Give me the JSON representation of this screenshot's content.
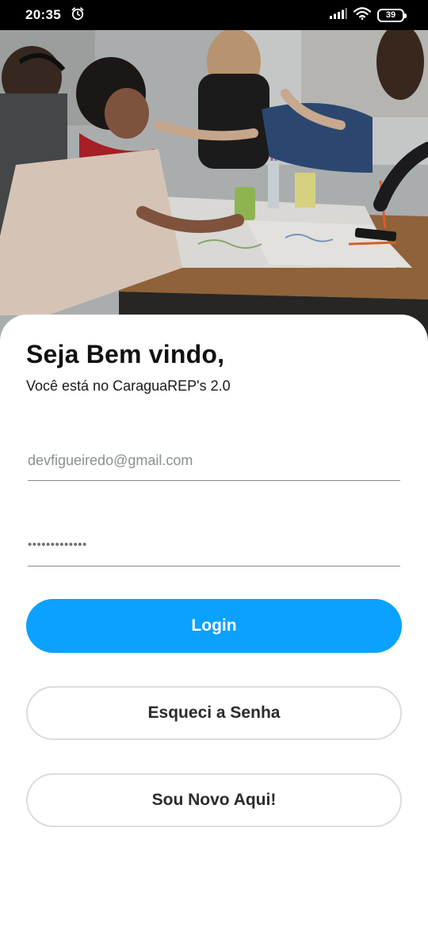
{
  "status_bar": {
    "time": "20:35",
    "alarm_icon": "alarm-clock-icon",
    "signal_icon": "cellular-signal-icon",
    "wifi_icon": "wifi-icon",
    "battery_level": "39"
  },
  "hero": {
    "image": "students-working-at-table-photo"
  },
  "welcome": {
    "title": "Seja Bem vindo,",
    "subtitle": "Você está no CaraguaREP's 2.0"
  },
  "form": {
    "email_value": "devfigueiredo@gmail.com",
    "password_mask": "•••••••••••••"
  },
  "buttons": {
    "login": "Login",
    "forgot_password": "Esqueci a Senha",
    "new_user": "Sou Novo Aqui!"
  },
  "colors": {
    "primary": "#0aa1ff",
    "outline_border": "#dcdcdc",
    "text_dark": "#111111"
  }
}
